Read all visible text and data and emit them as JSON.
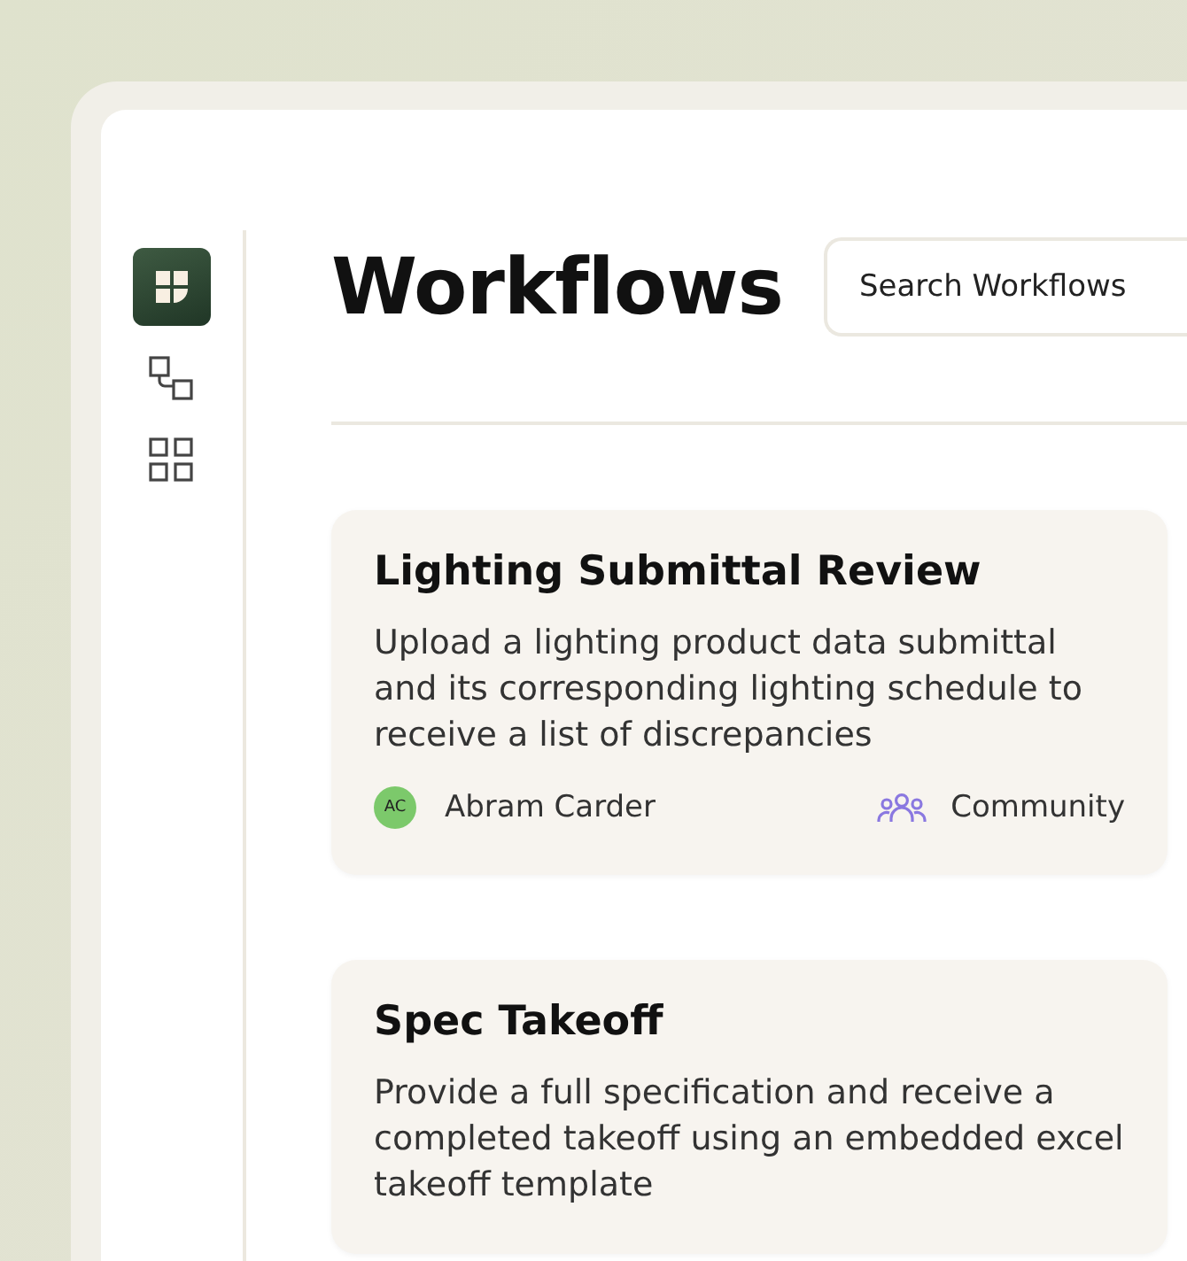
{
  "sidebar": {
    "items": [
      {
        "kind": "logo",
        "selected": true
      },
      {
        "kind": "workflows",
        "selected": false
      },
      {
        "kind": "apps",
        "selected": false
      }
    ]
  },
  "header": {
    "title": "Workflows",
    "search": {
      "placeholder": "Search Workflows"
    }
  },
  "cards": [
    {
      "title": "Lighting Submittal Review",
      "description": "Upload a lighting product data submittal and its corresponding lighting schedule to receive a list of discrepancies",
      "author": {
        "initials": "AC",
        "name": "Abram Carder",
        "color": "#7cc96b"
      },
      "visibility": "Community"
    },
    {
      "title": "Spec Takeoff",
      "description": "Provide a full specification and receive a completed takeoff using an embedded excel takeoff template"
    }
  ]
}
